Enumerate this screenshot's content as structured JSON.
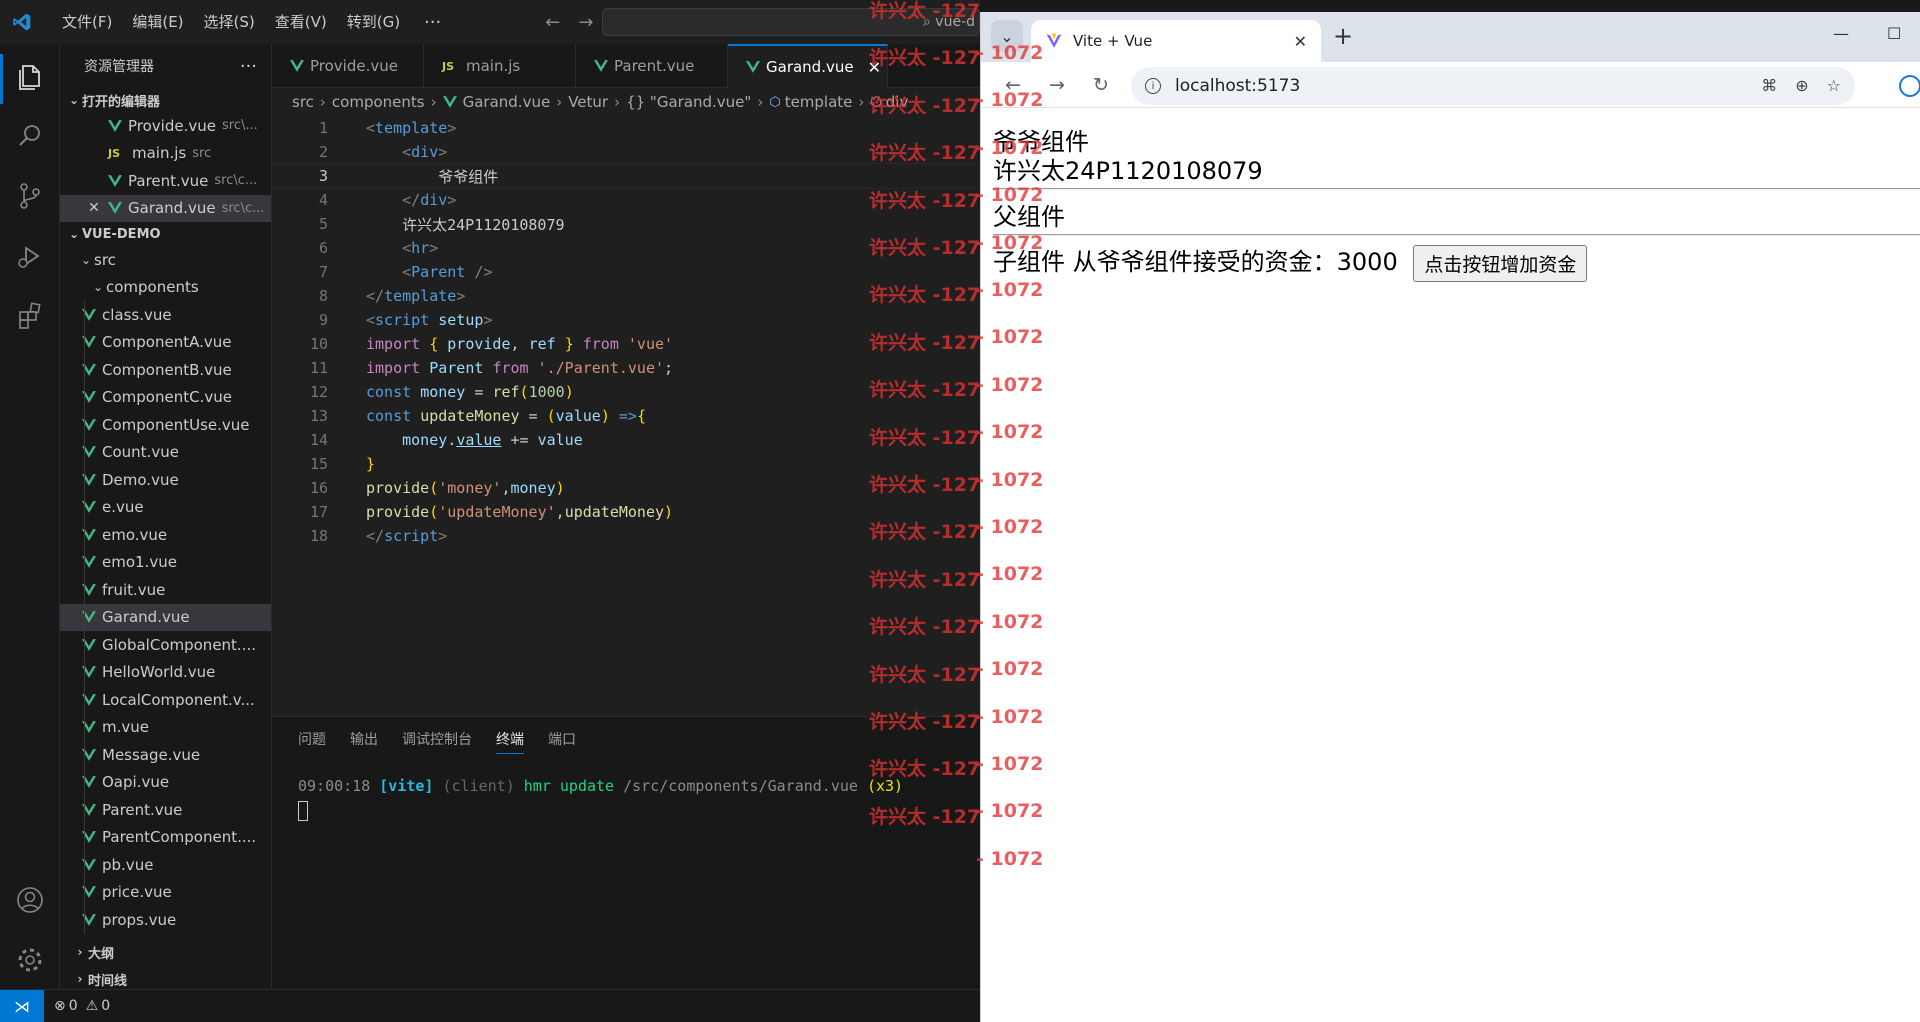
{
  "vscode": {
    "menu": [
      "文件(F)",
      "编辑(E)",
      "选择(S)",
      "查看(V)",
      "转到(G)"
    ],
    "menu_more": "···",
    "command_center": "vue-d",
    "sidebar": {
      "title": "资源管理器",
      "more": "···",
      "open_editors_label": "打开的编辑器",
      "open_editors": [
        {
          "name": "Provide.vue",
          "path": "src\\...",
          "kind": "vue"
        },
        {
          "name": "main.js",
          "path": "src",
          "kind": "js"
        },
        {
          "name": "Parent.vue",
          "path": "src\\c...",
          "kind": "vue"
        },
        {
          "name": "Garand.vue",
          "path": "src\\c...",
          "kind": "vue",
          "selected": true
        }
      ],
      "project_label": "VUE-DEMO",
      "folder_src": "src",
      "folder_components": "components",
      "files": [
        "class.vue",
        "ComponentA.vue",
        "ComponentB.vue",
        "ComponentC.vue",
        "ComponentUse.vue",
        "Count.vue",
        "Demo.vue",
        "e.vue",
        "emo.vue",
        "emo1.vue",
        "fruit.vue",
        "Garand.vue",
        "GlobalComponent....",
        "HelloWorld.vue",
        "LocalComponent.v...",
        "m.vue",
        "Message.vue",
        "Oapi.vue",
        "Parent.vue",
        "ParentComponent....",
        "pb.vue",
        "price.vue",
        "props.vue"
      ],
      "selected_file": "Garand.vue",
      "outline_label": "大纲",
      "timeline_label": "时间线"
    },
    "tabs": [
      {
        "name": "Provide.vue",
        "kind": "vue"
      },
      {
        "name": "main.js",
        "kind": "js"
      },
      {
        "name": "Parent.vue",
        "kind": "vue"
      },
      {
        "name": "Garand.vue",
        "kind": "vue",
        "active": true
      }
    ],
    "breadcrumb": [
      "src",
      "components",
      "Garand.vue",
      "Vetur",
      "{} \"Garand.vue\"",
      "template",
      "div"
    ],
    "line_numbers": [
      "1",
      "2",
      "3",
      "4",
      "5",
      "6",
      "7",
      "8",
      "9",
      "10",
      "11",
      "12",
      "13",
      "14",
      "15",
      "16",
      "17",
      "18"
    ],
    "current_line": 3,
    "panel_tabs": [
      "问题",
      "输出",
      "调试控制台",
      "终端",
      "端口"
    ],
    "active_panel_tab": "终端",
    "terminal": {
      "time": "09:00:18",
      "tag": "[vite]",
      "client": "(client)",
      "action": "hmr update",
      "path": "/src/components/Garand.vue",
      "count": "(x3)"
    },
    "status": {
      "errors": "0",
      "warnings": "0"
    }
  },
  "chrome": {
    "tab_title": "Vite + Vue",
    "url": "localhost:5173",
    "page": {
      "grandpa": "爷爷组件",
      "name_line": "许兴太24P1120108079",
      "parent": "父组件",
      "child_prefix": "子组件 从爷爷组件接受的资金：",
      "money": "3000",
      "button": "点击按钮增加资金"
    }
  },
  "watermark": {
    "text_a": "许兴太 -127",
    "text_b": "- 1072"
  },
  "colors": {
    "vscode_bg": "#1f1f1f",
    "accent": "#0078d4",
    "watermark": "#e13232",
    "vue_green": "#41b883"
  }
}
